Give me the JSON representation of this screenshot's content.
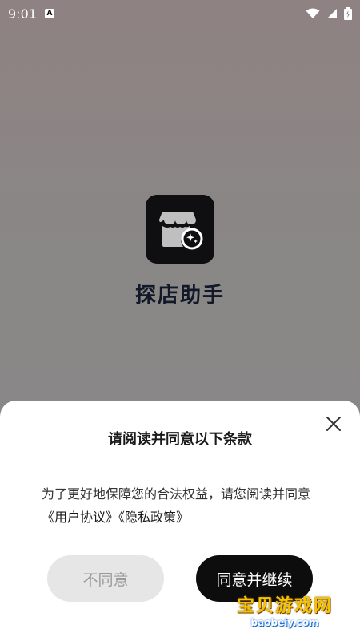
{
  "status_bar": {
    "time": "9:01",
    "badge": "A",
    "icons": [
      "wifi-icon",
      "signal-icon",
      "battery-icon"
    ]
  },
  "splash": {
    "app_name": "探店助手",
    "icon": "storefront-sparkle-icon"
  },
  "dialog": {
    "title": "请阅读并同意以下条款",
    "body_text": "为了更好地保障您的合法权益，请您阅读并同意",
    "user_agreement_link": "《用户协议》",
    "privacy_policy_link": "《隐私政策》",
    "disagree_label": "不同意",
    "agree_label": "同意并继续",
    "close_icon": "close-icon"
  },
  "watermark": {
    "main": "宝贝游戏网",
    "sub": "baobeiy.com"
  },
  "colors": {
    "overlay": "#888888",
    "sheet_bg": "#ffffff",
    "agree_bg": "#0d0d0d",
    "disagree_bg": "#e6e6e6"
  }
}
